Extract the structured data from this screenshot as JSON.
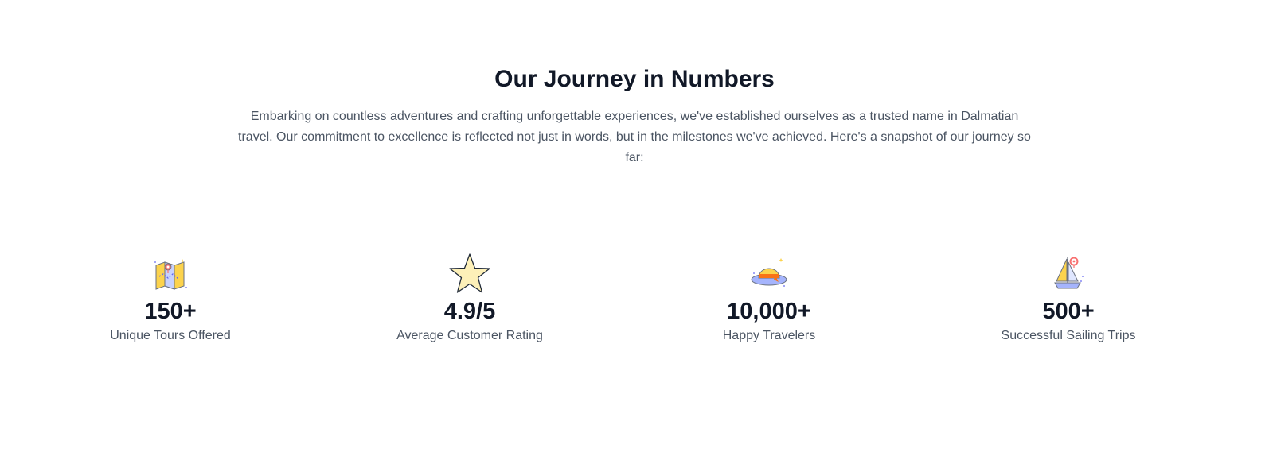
{
  "section": {
    "title": "Our Journey in Numbers",
    "intro": "Embarking on countless adventures and crafting unforgettable experiences, we've established ourselves as a trusted name in Dalmatian travel. Our commitment to excellence is reflected not just in words, but in the milestones we've achieved. Here's a snapshot of our journey so far:"
  },
  "stats": [
    {
      "icon": "folded-map-icon",
      "value": "150+",
      "label": "Unique Tours Offered"
    },
    {
      "icon": "star-icon",
      "value": "4.9/5",
      "label": "Average Customer Rating"
    },
    {
      "icon": "sun-hat-icon",
      "value": "10,000+",
      "label": "Happy Travelers"
    },
    {
      "icon": "sailboat-icon",
      "value": "500+",
      "label": "Successful Sailing Trips"
    }
  ],
  "colors": {
    "heading": "#111827",
    "body_text": "#4b5563",
    "icon_yellow": "#fcd34d",
    "icon_purple": "#a5b4fc",
    "icon_orange": "#f97316"
  }
}
